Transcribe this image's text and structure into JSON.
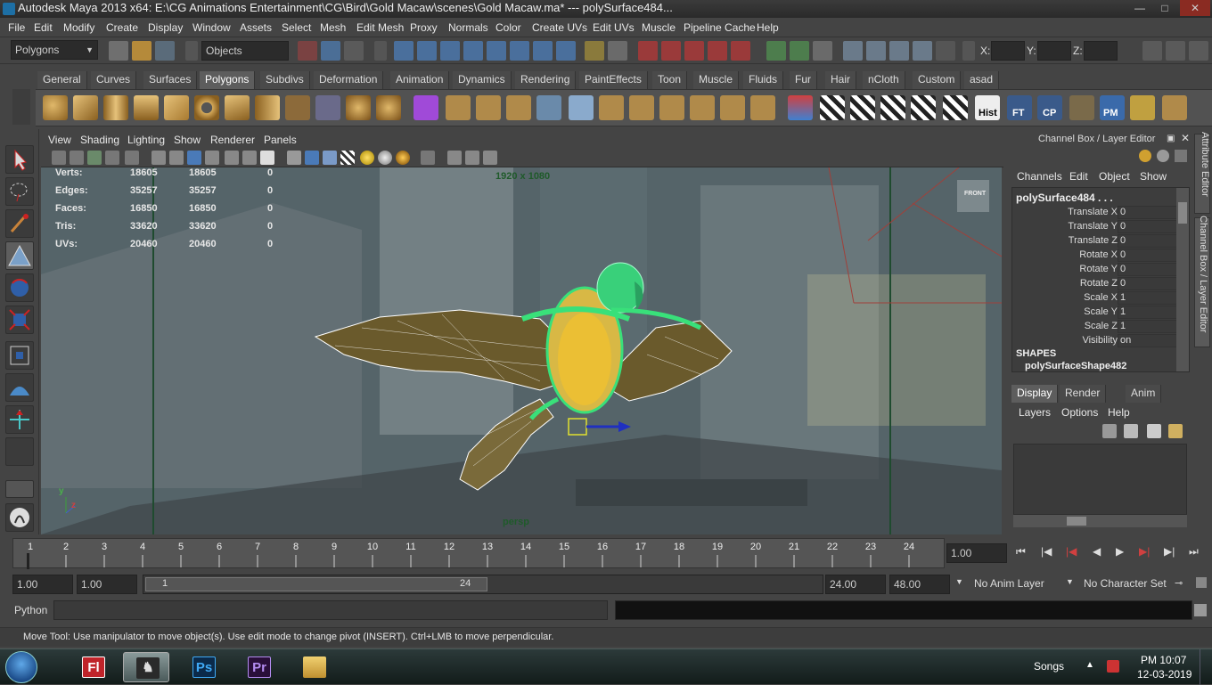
{
  "window": {
    "title": "Autodesk Maya 2013 x64: E:\\CG Animations Entertainment\\CG\\Bird\\Gold Macaw\\scenes\\Gold Macaw.ma*   ---   polySurface484...",
    "minimize": "—",
    "maximize": "□",
    "close": "✕"
  },
  "menus": [
    "File",
    "Edit",
    "Modify",
    "Create",
    "Display",
    "Window",
    "Assets",
    "Select",
    "Mesh",
    "Edit Mesh",
    "Proxy",
    "Normals",
    "Color",
    "Create UVs",
    "Edit UVs",
    "Muscle",
    "Pipeline Cache",
    "Help"
  ],
  "statusline": {
    "menuset": "Polygons",
    "selection_mode": "Objects",
    "x_label": "X:",
    "y_label": "Y:",
    "z_label": "Z:"
  },
  "shelf_tabs": [
    "General",
    "Curves",
    "Surfaces",
    "Polygons",
    "Subdivs",
    "Deformation",
    "Animation",
    "Dynamics",
    "Rendering",
    "PaintEffects",
    "Toon",
    "Muscle",
    "Fluids",
    "Fur",
    "Hair",
    "nCloth",
    "Custom",
    "asad"
  ],
  "shelf_active": "Polygons",
  "shelf_labels": {
    "hist": "Hist",
    "ft": "FT",
    "cp": "CP",
    "pm": "PM"
  },
  "panel_menu": [
    "View",
    "Shading",
    "Lighting",
    "Show",
    "Renderer",
    "Panels"
  ],
  "hud": {
    "resolution": "1920 x 1080",
    "camera": "persp",
    "stats": [
      {
        "label": "Verts:",
        "a": "18605",
        "b": "18605",
        "c": "0"
      },
      {
        "label": "Edges:",
        "a": "35257",
        "b": "35257",
        "c": "0"
      },
      {
        "label": "Faces:",
        "a": "16850",
        "b": "16850",
        "c": "0"
      },
      {
        "label": "Tris:",
        "a": "33620",
        "b": "33620",
        "c": "0"
      },
      {
        "label": "UVs:",
        "a": "20460",
        "b": "20460",
        "c": "0"
      }
    ],
    "axis_y": "y",
    "axis_z": "z",
    "cube_label": "FRONT"
  },
  "channel_box": {
    "title": "Channel Box / Layer Editor",
    "menus": [
      "Channels",
      "Edit",
      "Object",
      "Show"
    ],
    "object": "polySurface484 . . .",
    "channels": [
      {
        "label": "Translate X",
        "value": "0"
      },
      {
        "label": "Translate Y",
        "value": "0"
      },
      {
        "label": "Translate Z",
        "value": "0"
      },
      {
        "label": "Rotate X",
        "value": "0"
      },
      {
        "label": "Rotate Y",
        "value": "0"
      },
      {
        "label": "Rotate Z",
        "value": "0"
      },
      {
        "label": "Scale X",
        "value": "1"
      },
      {
        "label": "Scale Y",
        "value": "1"
      },
      {
        "label": "Scale Z",
        "value": "1"
      },
      {
        "label": "Visibility",
        "value": "on"
      }
    ],
    "shapes_header": "SHAPES",
    "shape_name": "polySurfaceShape482"
  },
  "side_tabs": {
    "attribute_editor": "Attribute Editor",
    "channel_layer": "Channel Box / Layer Editor"
  },
  "layer_editor": {
    "tabs": [
      "Display",
      "Render",
      "Anim"
    ],
    "active_tab": "Display",
    "menus": [
      "Layers",
      "Options",
      "Help"
    ]
  },
  "timeline": {
    "frames": [
      "1",
      "2",
      "3",
      "4",
      "5",
      "6",
      "7",
      "8",
      "9",
      "10",
      "11",
      "12",
      "13",
      "14",
      "15",
      "16",
      "17",
      "18",
      "19",
      "20",
      "21",
      "22",
      "23",
      "24"
    ],
    "current": "1.00"
  },
  "range": {
    "start": "1.00",
    "start2": "1.00",
    "slider_start": "1",
    "slider_end": "24",
    "end": "24.00",
    "end2": "48.00",
    "anim_layer": "No Anim Layer",
    "character_set": "No Character Set"
  },
  "cmdline": {
    "label": "Python"
  },
  "help_text": "Move Tool: Use manipulator to move object(s). Use edit mode to change pivot (INSERT).  Ctrl+LMB to move perpendicular.",
  "taskbar": {
    "apps": [
      {
        "name": "Fl",
        "color": "#c0242a",
        "text": "#ffffff"
      },
      {
        "name": "Ps",
        "color": "#0b2a4a",
        "text": "#3fa9f5"
      },
      {
        "name": "Pr",
        "color": "#2a0f3a",
        "text": "#b48cf0"
      }
    ],
    "songs": "Songs",
    "time": "PM 10:07",
    "date": "12-03-2019"
  }
}
